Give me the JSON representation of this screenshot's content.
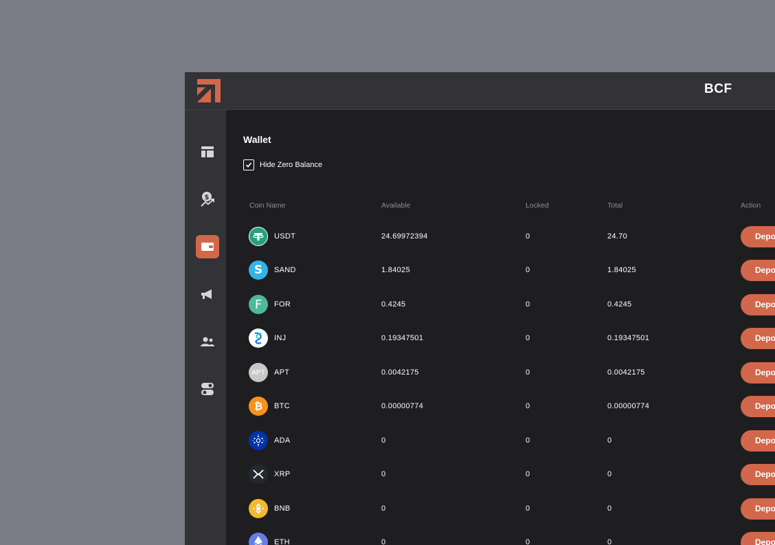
{
  "header": {
    "brand": "BCF"
  },
  "sidebar": {
    "items": [
      {
        "icon": "layout-icon",
        "active": false
      },
      {
        "icon": "earnings-icon",
        "active": false
      },
      {
        "icon": "wallet-icon",
        "active": true
      },
      {
        "icon": "megaphone-icon",
        "active": false
      },
      {
        "icon": "users-icon",
        "active": false
      },
      {
        "icon": "toggle-settings-icon",
        "active": false
      }
    ]
  },
  "wallet": {
    "title": "Wallet",
    "hide_zero_label": "Hide Zero Balance",
    "hide_zero_checked": true,
    "columns": {
      "coin_name": "Coin Name",
      "available": "Available",
      "locked": "Locked",
      "total": "Total",
      "action": "Action"
    },
    "deposit_label": "Depo",
    "rows": [
      {
        "coin": "USDT",
        "available": "24.69972394",
        "locked": "0",
        "total": "24.70",
        "icon": "usdt-icon",
        "color": "#26a17b"
      },
      {
        "coin": "SAND",
        "available": "1.84025",
        "locked": "0",
        "total": "1.84025",
        "icon": "sand-icon",
        "color": "#31b5e8"
      },
      {
        "coin": "FOR",
        "available": "0.4245",
        "locked": "0",
        "total": "0.4245",
        "icon": "for-icon",
        "color": "#4fb89a"
      },
      {
        "coin": "INJ",
        "available": "0.19347501",
        "locked": "0",
        "total": "0.19347501",
        "icon": "inj-icon",
        "color": "#0082fa"
      },
      {
        "coin": "APT",
        "available": "0.0042175",
        "locked": "0",
        "total": "0.0042175",
        "icon": "apt-icon",
        "color": "#c8c8c8",
        "icon_text": "APT"
      },
      {
        "coin": "BTC",
        "available": "0.00000774",
        "locked": "0",
        "total": "0.00000774",
        "icon": "btc-icon",
        "color": "#f7931a"
      },
      {
        "coin": "ADA",
        "available": "0",
        "locked": "0",
        "total": "0",
        "icon": "ada-icon",
        "color": "#0033ad"
      },
      {
        "coin": "XRP",
        "available": "0",
        "locked": "0",
        "total": "0",
        "icon": "xrp-icon",
        "color": "#23292f"
      },
      {
        "coin": "BNB",
        "available": "0",
        "locked": "0",
        "total": "0",
        "icon": "bnb-icon",
        "color": "#f3ba2f"
      },
      {
        "coin": "ETH",
        "available": "0",
        "locked": "0",
        "total": "0",
        "icon": "eth-icon",
        "color": "#627eea"
      }
    ]
  },
  "colors": {
    "accent": "#d2674b",
    "background": "#1e1e21",
    "panel": "#323237",
    "backdrop": "#7a7c86"
  }
}
